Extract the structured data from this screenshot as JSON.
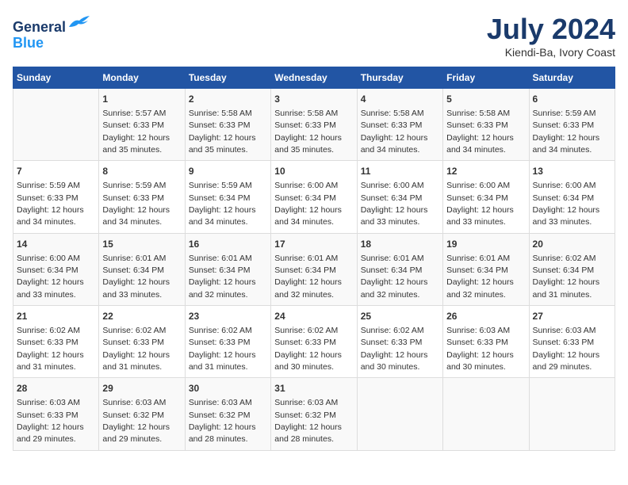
{
  "header": {
    "logo_line1": "General",
    "logo_line2": "Blue",
    "title": "July 2024",
    "subtitle": "Kiendi-Ba, Ivory Coast"
  },
  "days_of_week": [
    "Sunday",
    "Monday",
    "Tuesday",
    "Wednesday",
    "Thursday",
    "Friday",
    "Saturday"
  ],
  "weeks": [
    [
      {
        "day": "",
        "info": ""
      },
      {
        "day": "1",
        "info": "Sunrise: 5:57 AM\nSunset: 6:33 PM\nDaylight: 12 hours\nand 35 minutes."
      },
      {
        "day": "2",
        "info": "Sunrise: 5:58 AM\nSunset: 6:33 PM\nDaylight: 12 hours\nand 35 minutes."
      },
      {
        "day": "3",
        "info": "Sunrise: 5:58 AM\nSunset: 6:33 PM\nDaylight: 12 hours\nand 35 minutes."
      },
      {
        "day": "4",
        "info": "Sunrise: 5:58 AM\nSunset: 6:33 PM\nDaylight: 12 hours\nand 34 minutes."
      },
      {
        "day": "5",
        "info": "Sunrise: 5:58 AM\nSunset: 6:33 PM\nDaylight: 12 hours\nand 34 minutes."
      },
      {
        "day": "6",
        "info": "Sunrise: 5:59 AM\nSunset: 6:33 PM\nDaylight: 12 hours\nand 34 minutes."
      }
    ],
    [
      {
        "day": "7",
        "info": "Sunrise: 5:59 AM\nSunset: 6:33 PM\nDaylight: 12 hours\nand 34 minutes."
      },
      {
        "day": "8",
        "info": "Sunrise: 5:59 AM\nSunset: 6:33 PM\nDaylight: 12 hours\nand 34 minutes."
      },
      {
        "day": "9",
        "info": "Sunrise: 5:59 AM\nSunset: 6:34 PM\nDaylight: 12 hours\nand 34 minutes."
      },
      {
        "day": "10",
        "info": "Sunrise: 6:00 AM\nSunset: 6:34 PM\nDaylight: 12 hours\nand 34 minutes."
      },
      {
        "day": "11",
        "info": "Sunrise: 6:00 AM\nSunset: 6:34 PM\nDaylight: 12 hours\nand 33 minutes."
      },
      {
        "day": "12",
        "info": "Sunrise: 6:00 AM\nSunset: 6:34 PM\nDaylight: 12 hours\nand 33 minutes."
      },
      {
        "day": "13",
        "info": "Sunrise: 6:00 AM\nSunset: 6:34 PM\nDaylight: 12 hours\nand 33 minutes."
      }
    ],
    [
      {
        "day": "14",
        "info": "Sunrise: 6:00 AM\nSunset: 6:34 PM\nDaylight: 12 hours\nand 33 minutes."
      },
      {
        "day": "15",
        "info": "Sunrise: 6:01 AM\nSunset: 6:34 PM\nDaylight: 12 hours\nand 33 minutes."
      },
      {
        "day": "16",
        "info": "Sunrise: 6:01 AM\nSunset: 6:34 PM\nDaylight: 12 hours\nand 32 minutes."
      },
      {
        "day": "17",
        "info": "Sunrise: 6:01 AM\nSunset: 6:34 PM\nDaylight: 12 hours\nand 32 minutes."
      },
      {
        "day": "18",
        "info": "Sunrise: 6:01 AM\nSunset: 6:34 PM\nDaylight: 12 hours\nand 32 minutes."
      },
      {
        "day": "19",
        "info": "Sunrise: 6:01 AM\nSunset: 6:34 PM\nDaylight: 12 hours\nand 32 minutes."
      },
      {
        "day": "20",
        "info": "Sunrise: 6:02 AM\nSunset: 6:34 PM\nDaylight: 12 hours\nand 31 minutes."
      }
    ],
    [
      {
        "day": "21",
        "info": "Sunrise: 6:02 AM\nSunset: 6:33 PM\nDaylight: 12 hours\nand 31 minutes."
      },
      {
        "day": "22",
        "info": "Sunrise: 6:02 AM\nSunset: 6:33 PM\nDaylight: 12 hours\nand 31 minutes."
      },
      {
        "day": "23",
        "info": "Sunrise: 6:02 AM\nSunset: 6:33 PM\nDaylight: 12 hours\nand 31 minutes."
      },
      {
        "day": "24",
        "info": "Sunrise: 6:02 AM\nSunset: 6:33 PM\nDaylight: 12 hours\nand 30 minutes."
      },
      {
        "day": "25",
        "info": "Sunrise: 6:02 AM\nSunset: 6:33 PM\nDaylight: 12 hours\nand 30 minutes."
      },
      {
        "day": "26",
        "info": "Sunrise: 6:03 AM\nSunset: 6:33 PM\nDaylight: 12 hours\nand 30 minutes."
      },
      {
        "day": "27",
        "info": "Sunrise: 6:03 AM\nSunset: 6:33 PM\nDaylight: 12 hours\nand 29 minutes."
      }
    ],
    [
      {
        "day": "28",
        "info": "Sunrise: 6:03 AM\nSunset: 6:33 PM\nDaylight: 12 hours\nand 29 minutes."
      },
      {
        "day": "29",
        "info": "Sunrise: 6:03 AM\nSunset: 6:32 PM\nDaylight: 12 hours\nand 29 minutes."
      },
      {
        "day": "30",
        "info": "Sunrise: 6:03 AM\nSunset: 6:32 PM\nDaylight: 12 hours\nand 28 minutes."
      },
      {
        "day": "31",
        "info": "Sunrise: 6:03 AM\nSunset: 6:32 PM\nDaylight: 12 hours\nand 28 minutes."
      },
      {
        "day": "",
        "info": ""
      },
      {
        "day": "",
        "info": ""
      },
      {
        "day": "",
        "info": ""
      }
    ]
  ]
}
